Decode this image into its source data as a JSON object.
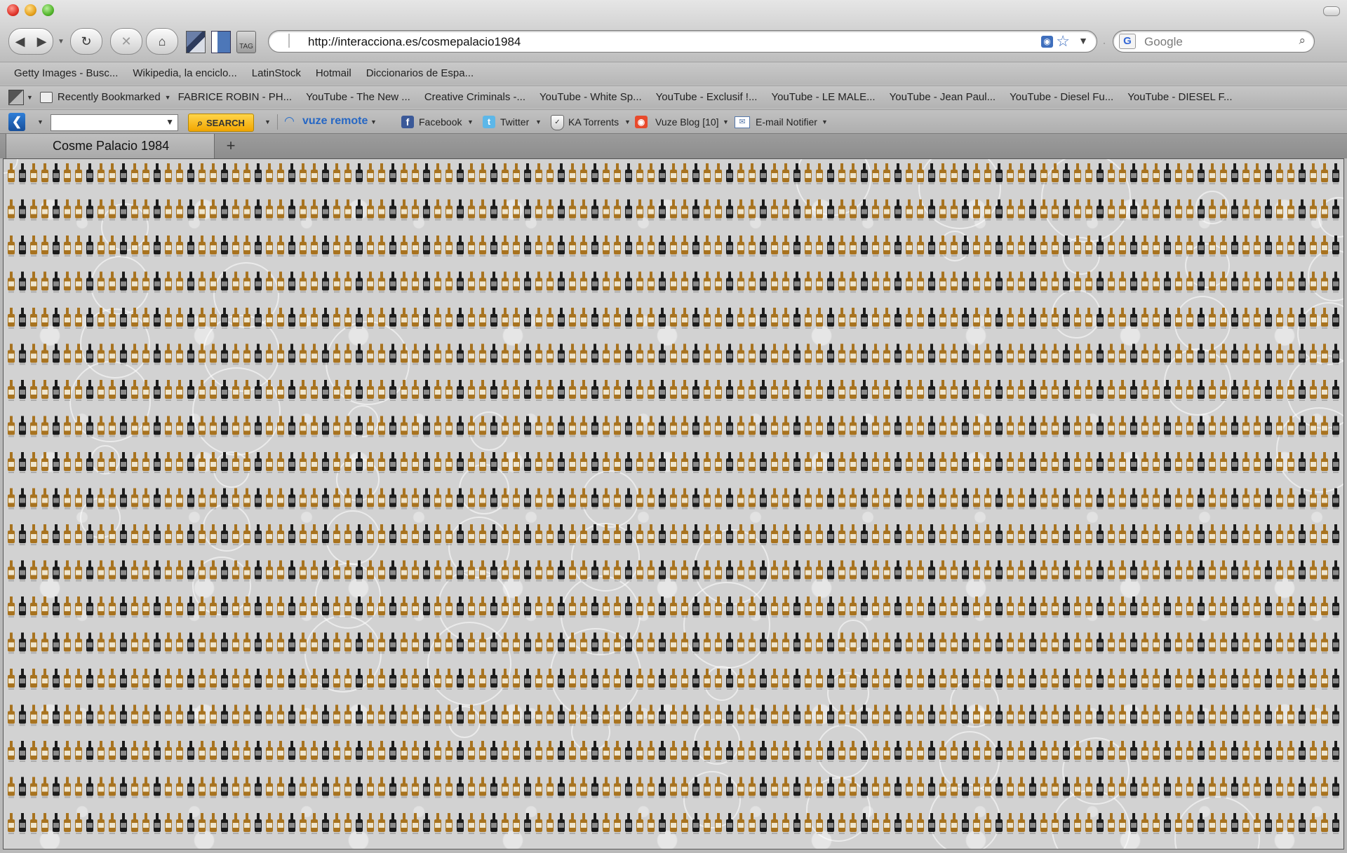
{
  "browser": {
    "back_glyph": "◀",
    "forward_glyph": "▶",
    "reload_glyph": "↻",
    "stop_glyph": "✕",
    "home_glyph": "⌂",
    "tag_label": "TAG",
    "url": "http://interacciona.es/cosmepalacio1984",
    "search_engine_glyph": "G",
    "search_placeholder": "Google"
  },
  "bookmarks_row1": [
    "Getty Images - Busc...",
    "Wikipedia, la enciclo...",
    "LatinStock",
    "Hotmail",
    "Diccionarios de Espa..."
  ],
  "bookmarks_row2": {
    "recent_label": "Recently Bookmarked",
    "items": [
      "FABRICE ROBIN - PH...",
      "YouTube - The New ...",
      "Creative Criminals -...",
      "YouTube - White Sp...",
      "YouTube - Exclusif !...",
      "YouTube - LE MALE...",
      "YouTube - Jean Paul...",
      "YouTube - Diesel Fu...",
      "YouTube - DIESEL F..."
    ]
  },
  "toolbar3": {
    "search_button": "SEARCH",
    "vuze_remote": "vuze remote",
    "facebook": "Facebook",
    "twitter": "Twitter",
    "ka_torrents": "KA Torrents",
    "vuze_blog": "Vuze Blog [10]",
    "email_notifier": "E-mail Notifier"
  },
  "tab": {
    "title": "Cosme Palacio 1984",
    "new_tab_glyph": "+"
  },
  "colors": {
    "bottle_amber": "#a8731f",
    "bottle_dark": "#1b1b1b",
    "label_cream": "#efe6cf",
    "pattern_bg": "#d2d2d2"
  }
}
